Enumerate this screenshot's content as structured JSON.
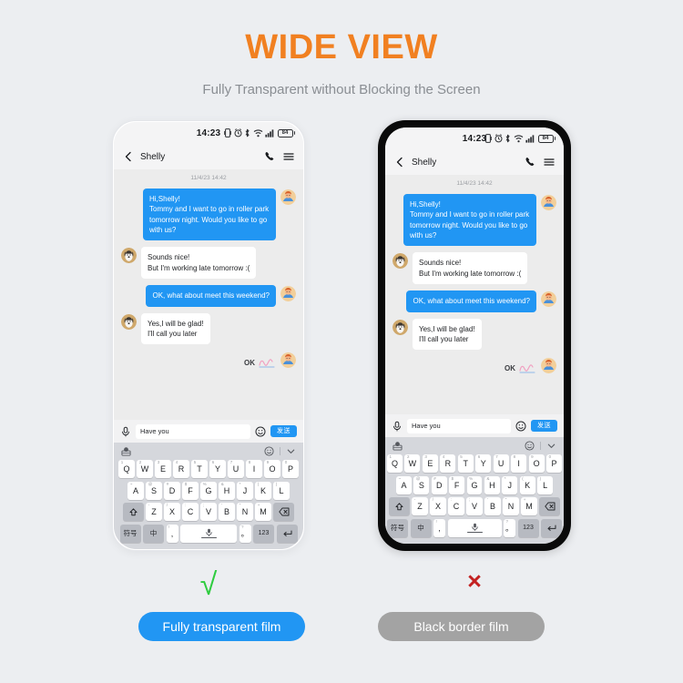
{
  "header": {
    "title": "WIDE VIEW",
    "subtitle": "Fully Transparent without Blocking the Screen",
    "title_color": "#f18021"
  },
  "phone": {
    "status": {
      "time": "14:23",
      "battery_level": "84",
      "icons": [
        "vibrate-icon",
        "alarm-icon",
        "bluetooth-icon",
        "wifi-icon",
        "signal-icon",
        "battery-icon"
      ]
    },
    "chat_header": {
      "peer_name": "Shelly",
      "back_icon": "back-chevron-icon",
      "call_icon": "phone-call-icon",
      "menu_icon": "hamburger-menu-icon"
    },
    "conversation": {
      "timestamp": "11/4/23 14:42",
      "messages": [
        {
          "side": "out",
          "text": "Hi,Shelly!\nTommy and I want to go in roller park tomorrow night. Would you like to go with us?"
        },
        {
          "side": "in",
          "text": "Sounds nice!\nBut I'm working late tomorrow :("
        },
        {
          "side": "out",
          "text": "OK, what about meet this weekend?"
        },
        {
          "side": "in",
          "text": "Yes,I will be glad!\nI'll call you later"
        }
      ],
      "sticker_label": "OK"
    },
    "input_bar": {
      "mic_icon": "microphone-icon",
      "value": "Have you",
      "placeholder": "Have you",
      "emoji_icon": "smiley-face-icon",
      "send_label": "发送"
    },
    "keyboard": {
      "toolbar": {
        "sticker_icon": "sticker-pack-icon",
        "emoji_icon": "smiley-face-icon",
        "collapse_icon": "chevron-down-icon"
      },
      "row1": [
        {
          "key": "Q",
          "sup": "1"
        },
        {
          "key": "W",
          "sup": "2"
        },
        {
          "key": "E",
          "sup": "3"
        },
        {
          "key": "R",
          "sup": "4"
        },
        {
          "key": "T",
          "sup": "5"
        },
        {
          "key": "Y",
          "sup": "6"
        },
        {
          "key": "U",
          "sup": "7"
        },
        {
          "key": "I",
          "sup": "8"
        },
        {
          "key": "O",
          "sup": "9"
        },
        {
          "key": "P",
          "sup": "0"
        }
      ],
      "row2": [
        {
          "key": "A",
          "sup": "~"
        },
        {
          "key": "S",
          "sup": "@"
        },
        {
          "key": "D",
          "sup": "#"
        },
        {
          "key": "F",
          "sup": "$"
        },
        {
          "key": "G",
          "sup": "%"
        },
        {
          "key": "H",
          "sup": "&"
        },
        {
          "key": "J",
          "sup": "*"
        },
        {
          "key": "K",
          "sup": "("
        },
        {
          "key": "L",
          "sup": ")"
        }
      ],
      "row3": [
        {
          "key": "Z",
          "sup": "-"
        },
        {
          "key": "X",
          "sup": "/"
        },
        {
          "key": "C",
          "sup": ":"
        },
        {
          "key": "V",
          "sup": ";"
        },
        {
          "key": "B",
          "sup": "'"
        },
        {
          "key": "N",
          "sup": "\""
        },
        {
          "key": "M",
          "sup": "+"
        }
      ],
      "shift_icon": "shift-arrow-icon",
      "backspace_icon": "backspace-icon",
      "symbols_label": "符号",
      "lang_label": "中",
      "lang_sub": "英",
      "comma_key": ",",
      "comma_sup": "!",
      "period_key": "。",
      "period_sup": "?",
      "space_icon": "microphone-icon",
      "numbers_label": "123",
      "enter_icon": "enter-return-icon"
    }
  },
  "footer": {
    "good": {
      "mark": "√",
      "mark_name": "green-check-mark",
      "label": "Fully transparent film",
      "color": "#2196f3"
    },
    "bad": {
      "mark": "×",
      "mark_name": "red-cross-mark",
      "label": "Black border film",
      "color": "#a3a3a3"
    }
  }
}
